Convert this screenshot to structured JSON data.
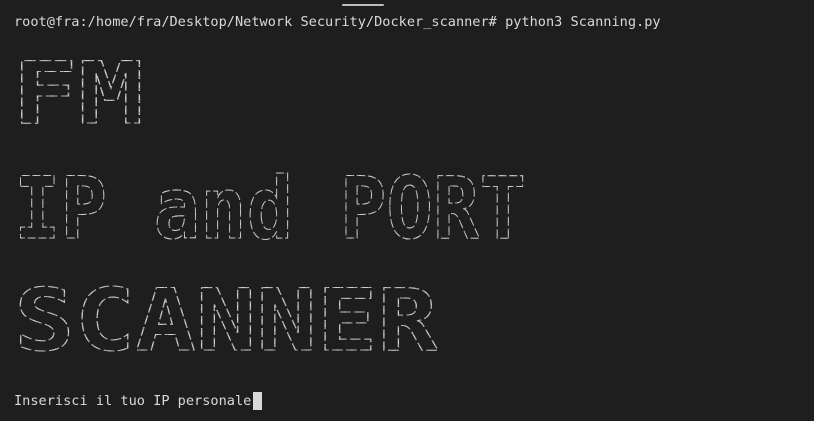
{
  "terminal": {
    "prompt": "root@fra:/home/fra/Desktop/Network Security/Docker_scanner#",
    "command": "python3 Scanning.py",
    "banner_lines": [
      "FM",
      "IP and PORT",
      "SCANNER"
    ],
    "input_prompt": "Inserisci il tuo IP personale"
  }
}
